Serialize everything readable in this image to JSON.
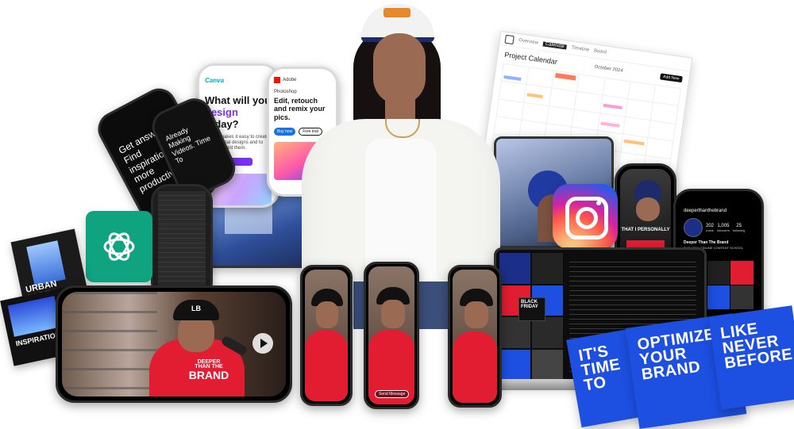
{
  "canva": {
    "logo": "Canva",
    "heading_plain_1": "What will you ",
    "heading_highlight": "design",
    "heading_plain_2": " today?",
    "subtext": "Canva makes it easy to create professional designs and to share or print them."
  },
  "photoshop": {
    "app_name": "Photoshop",
    "tagline": "Edit, retouch and remix your pics.",
    "buy_label": "Buy now",
    "trial_label": "Free trial"
  },
  "chatgpt_phone": {
    "text": "Get answers. Find inspiration. Be more productive."
  },
  "dark_phone": {
    "text": "Already Making Videos. Time To"
  },
  "calendar": {
    "title": "Project Calendar",
    "month": "October 2024",
    "tabs": [
      "Overview",
      "Calendar",
      "Timeline",
      "Board"
    ],
    "add_label": "Add New"
  },
  "instagram": {
    "handle": "deeperthanthebrand",
    "posts": "202",
    "followers": "1,005",
    "following": "25",
    "posts_label": "posts",
    "followers_label": "followers",
    "following_label": "following",
    "display_name": "Deeper Than The Brand",
    "bio": "THE VIRAL ONLINE CONTENT SCHOOL"
  },
  "story_phone": {
    "caption": "THAT I PERSONALLY"
  },
  "video_screen": {
    "shirt_line1": "DEEPER",
    "shirt_line2": "THAN THE",
    "shirt_line3": "BRAND",
    "cap_logo": "LB"
  },
  "reel_phone": {
    "send_label": "Send Message"
  },
  "thumbnails": {
    "black_friday": "BLACK FRIDAY"
  },
  "poster_left": {
    "top": "URBAN PARTY",
    "bottom": "INSPIRATION"
  },
  "cards": {
    "card1": [
      "IT'S",
      "TIME",
      "TO"
    ],
    "card2": [
      "OPTIMIZE",
      "YOUR",
      "BRAND"
    ],
    "card3": [
      "LIKE",
      "NEVER",
      "BEFORE"
    ]
  },
  "colors": {
    "blue_card": "#1d4fe0",
    "brand_red": "#e21d32",
    "chatgpt_green": "#10a37f",
    "canva_purple": "#7b2ff7"
  },
  "icons": [
    "chatgpt-logo-icon",
    "instagram-logo-icon",
    "play-icon"
  ]
}
